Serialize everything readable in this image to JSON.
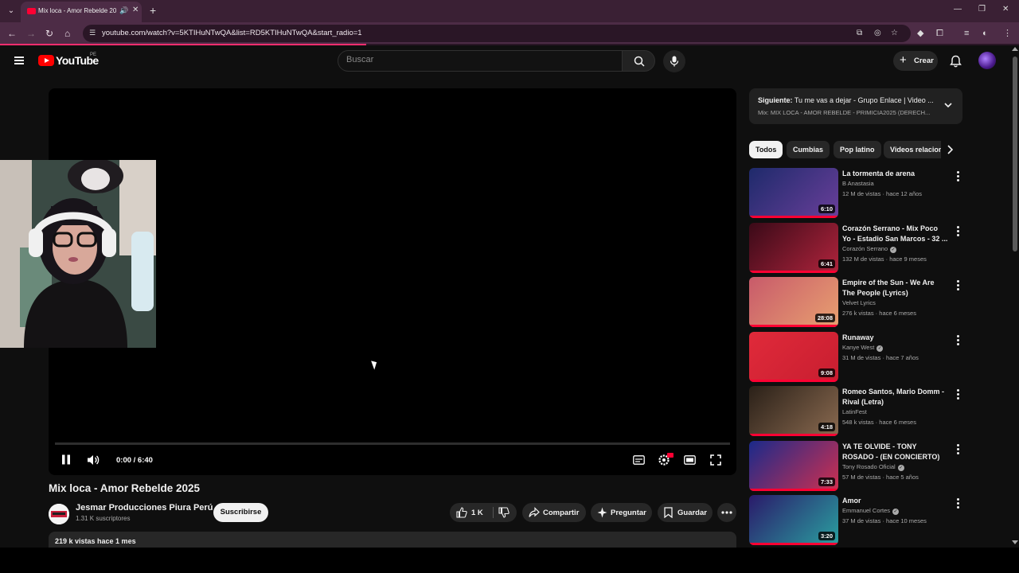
{
  "browser": {
    "tab_title": "Mix loca - Amor Rebelde 20",
    "url": "youtube.com/watch?v=5KTIHuNTwQA&list=RD5KTIHuNTwQA&start_radio=1"
  },
  "header": {
    "logo_text": "YouTube",
    "country_code": "PE",
    "search_placeholder": "Buscar",
    "create_label": "Crear"
  },
  "player": {
    "time_display": "0:00 / 6:40"
  },
  "video": {
    "title": "Mix loca - Amor Rebelde 2025",
    "channel_name": "Jesmar Producciones Piura Perú",
    "subscribers": "1.31 K suscriptores",
    "subscribe_label": "Suscribirse",
    "likes": "1 K",
    "share_label": "Compartir",
    "ask_label": "Preguntar",
    "save_label": "Guardar",
    "views_date": "219 k vistas  hace 1 mes"
  },
  "up_next": {
    "label": "Siguiente:",
    "title": "Tu me vas a dejar - Grupo Enlace | Video ...",
    "playlist": "Mix: MIX LOCA - AMOR REBELDE - PRIMICIA2025 (DERECH..."
  },
  "chips": [
    "Todos",
    "Cumbias",
    "Pop latino",
    "Videos relacionados"
  ],
  "recommendations": [
    {
      "title": "La tormenta de arena",
      "channel": "B Anastasia",
      "verified": false,
      "meta": "12 M de vistas · hace 12 años",
      "duration": "6:10",
      "thumb_colors": [
        "#1e2a6b",
        "#6a3f9a"
      ]
    },
    {
      "title": "Corazón Serrano - Mix Poco Yo - Estadio San Marcos - 32 ...",
      "channel": "Corazón Serrano",
      "verified": true,
      "meta": "132 M de vistas · hace 9 meses",
      "duration": "6:41",
      "thumb_colors": [
        "#3a0a18",
        "#b0243c"
      ]
    },
    {
      "title": "Empire of the Sun - We Are The People (Lyrics)",
      "channel": "Velvet Lyrics",
      "verified": false,
      "meta": "276 k vistas · hace 6 meses",
      "duration": "28:08",
      "thumb_colors": [
        "#c85a6a",
        "#e8a070"
      ]
    },
    {
      "title": "Runaway",
      "channel": "Kanye West",
      "verified": true,
      "meta": "31 M de vistas · hace 7 años",
      "duration": "9:08",
      "thumb_colors": [
        "#e02a3a",
        "#c81e30"
      ]
    },
    {
      "title": "Romeo Santos, Mario Domm - Rival (Letra)",
      "channel": "LatinFest",
      "verified": false,
      "meta": "548 k vistas · hace 6 meses",
      "duration": "4:18",
      "thumb_colors": [
        "#2a2018",
        "#8a6a50"
      ]
    },
    {
      "title": "YA TE OLVIDE - TONY ROSADO - (EN CONCIERTO)",
      "channel": "Tony Rosado Oficial",
      "verified": true,
      "meta": "57 M de vistas · hace 5 años",
      "duration": "7:33",
      "thumb_colors": [
        "#1a2a8a",
        "#d03050"
      ]
    },
    {
      "title": "Amor",
      "channel": "Emmanuel Cortes",
      "verified": true,
      "meta": "37 M de vistas · hace 10 meses",
      "duration": "3:20",
      "thumb_colors": [
        "#2a1a6a",
        "#2aa0a0"
      ]
    }
  ]
}
